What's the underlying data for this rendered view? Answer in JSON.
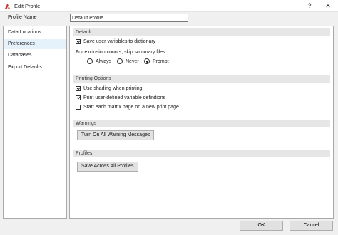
{
  "window": {
    "title": "Edit Profile",
    "app_icon": "app-logo-icon",
    "help_label": "?",
    "close_label": "✕"
  },
  "profile": {
    "label": "Profile Name",
    "value": "Default Profile"
  },
  "nav": {
    "items": [
      {
        "label": "Data Locations"
      },
      {
        "label": "Preferences"
      },
      {
        "label": "Databases"
      },
      {
        "label": "Export Defaults"
      }
    ],
    "selected": "Preferences"
  },
  "default_section": {
    "header": "Default",
    "save_vars": {
      "label": "Save user variables to dictionary",
      "checked": true
    },
    "exclusion_label": "For exclusion counts, skip summary files",
    "radios": [
      {
        "label": "Always",
        "checked": false
      },
      {
        "label": "Never",
        "checked": false
      },
      {
        "label": "Prompt",
        "checked": true
      }
    ]
  },
  "printing_section": {
    "header": "Printing Options",
    "options": [
      {
        "label": "Use shading when printing",
        "checked": true
      },
      {
        "label": "Print user-defined variable definitions",
        "checked": true
      },
      {
        "label": "Start each matrix page on a new print page",
        "checked": false
      }
    ]
  },
  "warnings_section": {
    "header": "Warnings",
    "button": "Turn On All Warning Messages"
  },
  "profiles_section": {
    "header": "Profiles",
    "button": "Save Across All Profiles"
  },
  "footer": {
    "ok": "OK",
    "cancel": "Cancel"
  },
  "colors": {
    "selected_nav": "#e5f1fb",
    "section_header": "#e6e6e6",
    "icon_red": "#c0392b"
  }
}
